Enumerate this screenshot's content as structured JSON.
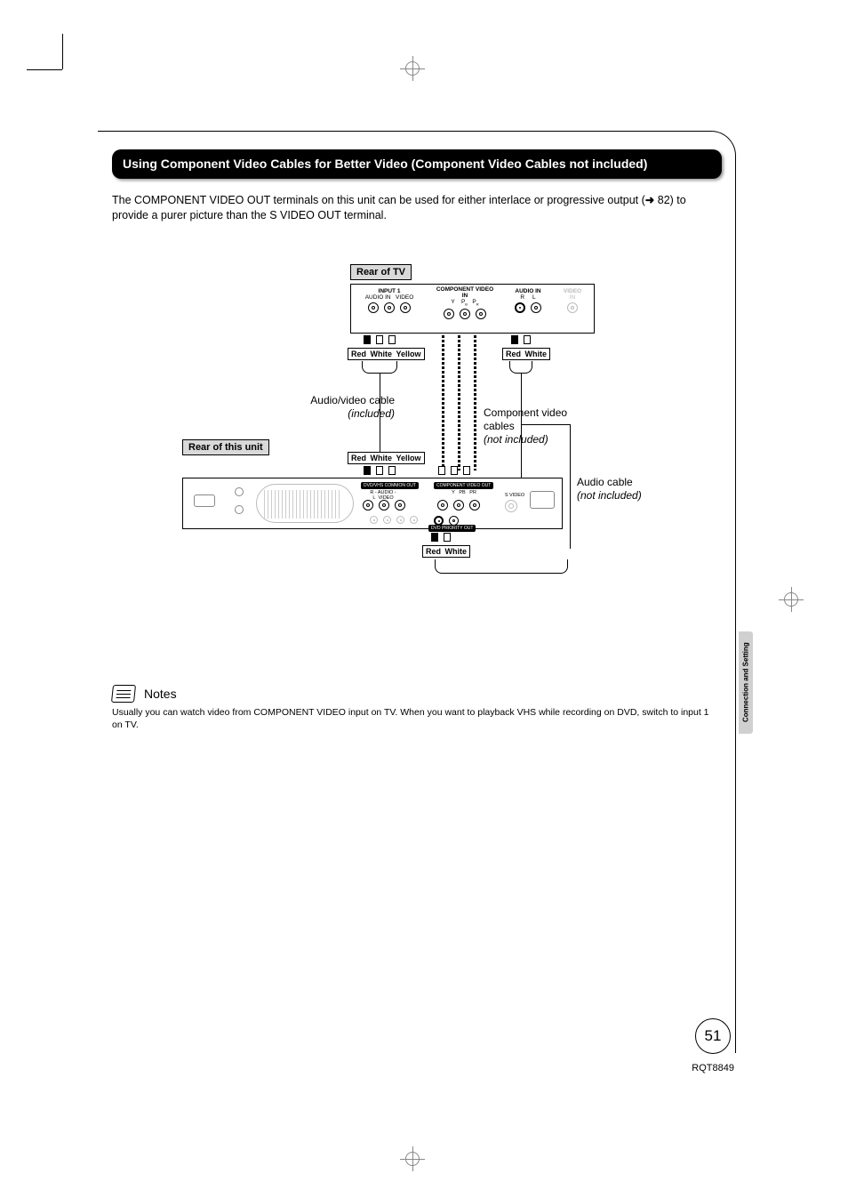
{
  "header": {
    "title": "Using Component Video Cables for Better Video (Component Video Cables not included)"
  },
  "intro": {
    "text_a": "The COMPONENT VIDEO OUT terminals on this unit can be used for either interlace or progressive output (",
    "ref": "82",
    "text_b": ") to provide a purer picture than the S VIDEO OUT terminal."
  },
  "diagram": {
    "labels": {
      "rear_tv": "Rear of TV",
      "rear_unit": "Rear of this unit"
    },
    "plug_groups": {
      "rwy": [
        "Red",
        "White",
        "Yellow"
      ],
      "rw": [
        "Red",
        "White"
      ]
    },
    "captions": {
      "av_cable": "Audio/video cable",
      "av_cable_note": "(included)",
      "component": "Component video cables",
      "component_note": "(not included)",
      "audio_cable": "Audio cable",
      "audio_cable_note": "(not included)"
    },
    "tv_panel": {
      "input1": "INPUT 1",
      "audio_in": "AUDIO IN",
      "video": "VIDEO",
      "component_in": "COMPONENT VIDEO IN",
      "y": "Y",
      "pb": "P",
      "pb_sub": "B",
      "pr": "P",
      "pr_sub": "R",
      "audio_in2": "AUDIO IN",
      "r": "R",
      "l": "L",
      "video2": "VIDEO",
      "in": "IN"
    },
    "unit_panel": {
      "common_out": "DVD/VHS COMMON OUT",
      "r_audio_l": "R - AUDIO - L",
      "video": "VIDEO",
      "component_out": "COMPONENT VIDEO OUT",
      "y": "Y",
      "pb": "PB",
      "pr": "PR",
      "svideo": "S VIDEO",
      "priority_out": "DVD PRIORITY OUT"
    }
  },
  "notes": {
    "title": "Notes",
    "body": "Usually you can watch video from COMPONENT VIDEO input on TV. When you want to playback VHS while recording on DVD, switch to input 1 on TV."
  },
  "side_tab": "Connection and Setting",
  "page_number": "51",
  "doc_id": "RQT8849"
}
